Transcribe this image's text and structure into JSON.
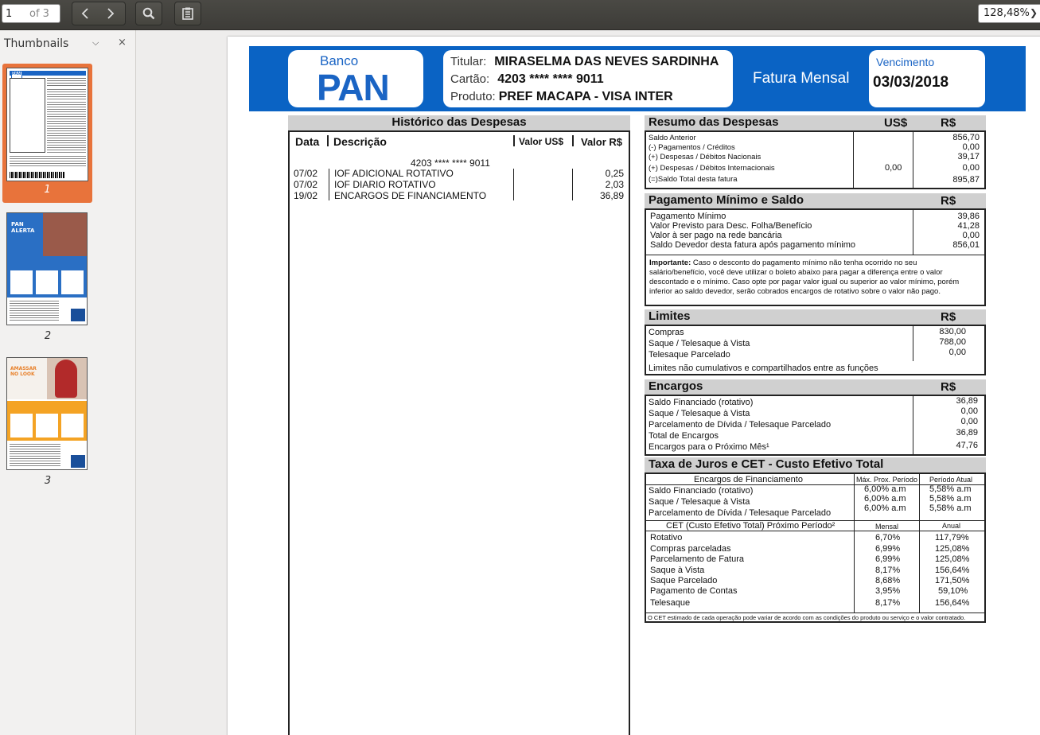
{
  "toolbar": {
    "page_current": "1",
    "page_total": "of 3",
    "zoom_value": "128,48%"
  },
  "sidebar": {
    "title": "Thumbnails",
    "thumbnails": [
      {
        "label": "1",
        "thumb_text": "PAN"
      },
      {
        "label": "2",
        "thumb_text": "PAN ALERTA"
      },
      {
        "label": "3",
        "thumb_text": "AMASSAR NO LOOK"
      }
    ]
  },
  "header": {
    "logo_banco": "Banco",
    "logo_pan": "PAN",
    "titular_label": "Titular:",
    "titular": "MIRASELMA DAS NEVES SARDINHA",
    "cartao_label": "Cartão:",
    "cartao": "4203 **** **** 9011",
    "produto_label": "Produto:",
    "produto": "PREF MACAPA - VISA INTER",
    "fatura_label": "Fatura Mensal",
    "vencimento_label": "Vencimento",
    "vencimento": "03/03/2018"
  },
  "historico": {
    "title": "Histórico das Despesas",
    "col_data": "Data",
    "col_desc": "Descrição",
    "col_usd": "Valor US$",
    "col_brl": "Valor R$",
    "card": "4203 **** **** 9011",
    "rows": [
      {
        "data": "07/02",
        "desc": "IOF ADICIONAL ROTATIVO",
        "valor": "0,25"
      },
      {
        "data": "07/02",
        "desc": "IOF DIARIO ROTATIVO",
        "valor": "2,03"
      },
      {
        "data": "19/02",
        "desc": "ENCARGOS DE FINANCIAMENTO",
        "valor": "36,89"
      }
    ]
  },
  "resumo": {
    "title": "Resumo das Despesas",
    "col_usd": "US$",
    "col_brl": "R$",
    "rows": [
      {
        "label": "Saldo Anterior",
        "usd": "",
        "brl": "856,70"
      },
      {
        "label": "(-) Pagamentos / Créditos",
        "usd": "",
        "brl": "0,00"
      },
      {
        "label": "(+) Despesas / Débitos Nacionais",
        "usd": "",
        "brl": "39,17"
      },
      {
        "label": "(+) Despesas / Débitos Internacionais",
        "usd": "0,00",
        "brl": "0,00"
      },
      {
        "label": "(=)Saldo Total desta fatura",
        "usd": "",
        "brl": "895,87"
      }
    ]
  },
  "pagamento": {
    "title": "Pagamento Mínimo e Saldo",
    "col_brl": "R$",
    "rows": [
      {
        "label": "Pagamento Mínimo",
        "brl": "39,86"
      },
      {
        "label": "Valor Previsto para Desc. Folha/Benefício",
        "brl": "41,28"
      },
      {
        "label": "Valor à ser pago na rede bancária",
        "brl": "0,00"
      },
      {
        "label": "Saldo Devedor desta fatura após pagamento mínimo",
        "brl": "856,01"
      }
    ],
    "importante_label": "Importante:",
    "importante_l1": "Caso o desconto do pagamento mínimo não tenha ocorrido no seu",
    "importante_l2": "salário/benefício, você deve utilizar o boleto abaixo para pagar a diferença entre o valor",
    "importante_l3": "descontado e o mínimo. Caso opte por pagar valor igual ou superior ao valor mínimo, porém",
    "importante_l4": "inferior ao saldo devedor, serão cobrados encargos de rotativo sobre o valor não pago."
  },
  "limites": {
    "title": "Limites",
    "col_brl": "R$",
    "rows": [
      {
        "label": "Compras",
        "brl": "830,00"
      },
      {
        "label": "Saque / Telesaque à Vista",
        "brl": "788,00"
      },
      {
        "label": "Telesaque Parcelado",
        "brl": "0,00"
      }
    ],
    "note": "Limites não cumulativos e compartilhados entre as funções"
  },
  "encargos": {
    "title": "Encargos",
    "col_brl": "R$",
    "rows": [
      {
        "label": "Saldo Financiado (rotativo)",
        "brl": "36,89"
      },
      {
        "label": "Saque / Telesaque à Vista",
        "brl": "0,00"
      },
      {
        "label": "Parcelamento de Dívida / Telesaque Parcelado",
        "brl": "0,00"
      },
      {
        "label": "Total de Encargos",
        "brl": "36,89"
      },
      {
        "label": "Encargos para o Próximo Mês¹",
        "brl": "47,76"
      }
    ]
  },
  "taxa": {
    "title": "Taxa de Juros e CET - Custo Efetivo Total",
    "enc_header": "Encargos de Financiamento",
    "col_max": "Máx. Prox. Período",
    "col_atual": "Período Atual",
    "enc_rows": [
      {
        "label": "Saldo Financiado (rotativo)",
        "max": "6,00% a.m",
        "atual": "5,58% a.m"
      },
      {
        "label": "Saque / Telesaque à Vista",
        "max": "6,00% a.m",
        "atual": "5,58% a.m"
      },
      {
        "label": "Parcelamento de Dívida / Telesaque Parcelado",
        "max": "6,00% a.m",
        "atual": "5,58% a.m"
      }
    ],
    "cet_header": "CET (Custo Efetivo Total) Próximo Período²",
    "col_mensal": "Mensal",
    "col_anual": "Anual",
    "cet_rows": [
      {
        "label": "Rotativo",
        "mensal": "6,70%",
        "anual": "117,79%"
      },
      {
        "label": "Compras parceladas",
        "mensal": "6,99%",
        "anual": "125,08%"
      },
      {
        "label": "Parcelamento de Fatura",
        "mensal": "6,99%",
        "anual": "125,08%"
      },
      {
        "label": "Saque à Vista",
        "mensal": "8,17%",
        "anual": "156,64%"
      },
      {
        "label": "Saque Parcelado",
        "mensal": "8,68%",
        "anual": "171,50%"
      },
      {
        "label": "Pagamento de Contas",
        "mensal": "3,95%",
        "anual": "59,10%"
      },
      {
        "label": "Telesaque",
        "mensal": "8,17%",
        "anual": "156,64%"
      }
    ],
    "footnote": "O CET estimado de cada operação pode variar de acordo com as condições do produto ou serviço e o valor contratado."
  }
}
